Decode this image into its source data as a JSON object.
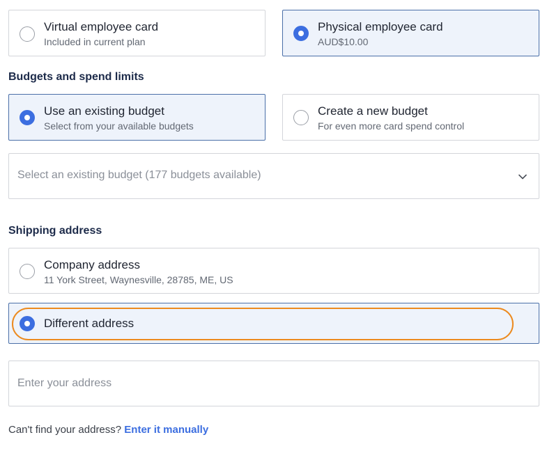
{
  "card_type": {
    "virtual": {
      "title": "Virtual employee card",
      "subtitle": "Included in current plan",
      "selected": false
    },
    "physical": {
      "title": "Physical employee card",
      "subtitle": "AUD$10.00",
      "selected": true
    }
  },
  "budgets": {
    "heading": "Budgets and spend limits",
    "existing": {
      "title": "Use an existing budget",
      "subtitle": "Select from your available budgets",
      "selected": true
    },
    "new": {
      "title": "Create a new budget",
      "subtitle": "For even more card spend control",
      "selected": false
    },
    "select_placeholder": "Select an existing budget (177 budgets available)"
  },
  "shipping": {
    "heading": "Shipping address",
    "company": {
      "title": "Company address",
      "subtitle": "11 York Street, Waynesville, 28785, ME, US",
      "selected": false
    },
    "different": {
      "title": "Different address",
      "selected": true
    },
    "address_placeholder": "Enter your address",
    "help_text": "Can't find your address? ",
    "help_link": "Enter it manually"
  },
  "colors": {
    "accent": "#3c6ee0",
    "selected_bg": "#eef3fb",
    "highlight": "#ec8a1e",
    "heading": "#1d2b4a"
  }
}
